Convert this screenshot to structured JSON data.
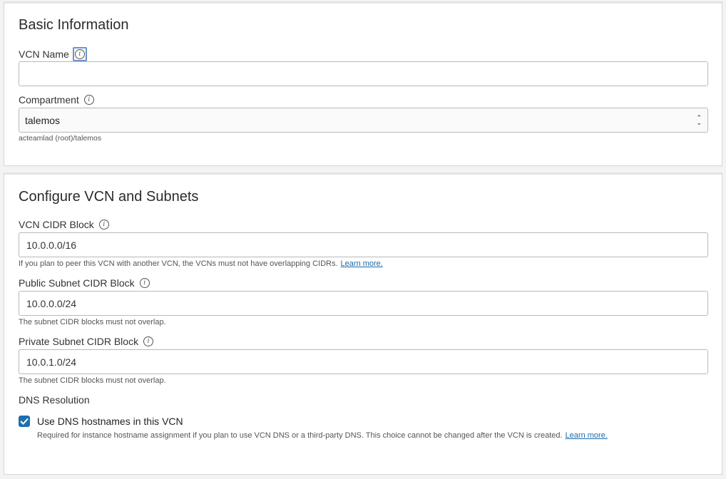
{
  "basic_information": {
    "heading": "Basic Information",
    "vcn_name": {
      "label": "VCN Name",
      "value": "",
      "placeholder": ""
    },
    "compartment": {
      "label": "Compartment",
      "selected": "talemos",
      "path": "acteamlad (root)/talemos"
    }
  },
  "configure": {
    "heading": "Configure VCN and Subnets",
    "vcn_cidr": {
      "label": "VCN CIDR Block",
      "value": "10.0.0.0/16",
      "help": "If you plan to peer this VCN with another VCN, the VCNs must not have overlapping CIDRs.",
      "help_link": "Learn more."
    },
    "public_subnet": {
      "label": "Public Subnet CIDR Block",
      "value": "10.0.0.0/24",
      "help": "The subnet CIDR blocks must not overlap."
    },
    "private_subnet": {
      "label": "Private Subnet CIDR Block",
      "value": "10.0.1.0/24",
      "help": "The subnet CIDR blocks must not overlap."
    },
    "dns": {
      "label": "DNS Resolution",
      "checkbox_label": "Use DNS hostnames in this VCN",
      "checked": true,
      "help": "Required for instance hostname assignment if you plan to use VCN DNS or a third-party DNS. This choice cannot be changed after the VCN is created.",
      "help_link": "Learn more."
    }
  },
  "icons": {
    "info": "info-icon",
    "checkmark": "checkmark-icon",
    "select_chevron": "select-chevron-icon"
  },
  "colors": {
    "accent": "#1d6fb0",
    "link": "#1a6aa9",
    "focus_ring": "#6b94c9"
  }
}
